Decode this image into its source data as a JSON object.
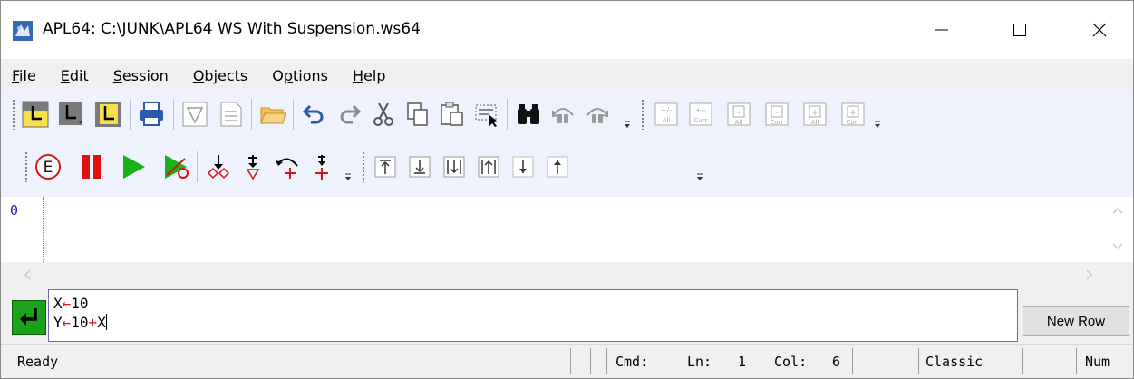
{
  "window": {
    "title": "APL64: C:\\JUNK\\APL64 WS With Suspension.ws64",
    "icon": "apl64-app-icon"
  },
  "menu": [
    {
      "label": "File",
      "underline": "F",
      "rest": "ile"
    },
    {
      "label": "Edit",
      "underline": "E",
      "rest": "dit"
    },
    {
      "label": "Session",
      "underline": "S",
      "rest": "ession"
    },
    {
      "label": "Objects",
      "underline": "O",
      "rest": "bjects"
    },
    {
      "label": "Options",
      "pre": "O",
      "underline": "p",
      "rest": "tions"
    },
    {
      "label": "Help",
      "underline": "H",
      "rest": "elp"
    }
  ],
  "toolbar1": {
    "icons": [
      "session-window-icon",
      "new-window-icon",
      "rebuild-window-icon",
      "print-icon",
      "find-icon",
      "notepad-icon",
      "open-folder-icon",
      "undo-icon",
      "redo-icon",
      "cut-icon",
      "copy-icon",
      "paste-icon",
      "select-icon",
      "binoculars-icon",
      "find-previous-icon",
      "find-next-icon",
      "toggle-all-icon",
      "toggle-current-icon",
      "collapse-all-icon",
      "collapse-current-icon",
      "expand-all-icon",
      "expand-current-icon"
    ],
    "small_labels": {
      "toggle_all": "+/-",
      "toggle_curr": "+/-",
      "all": "All",
      "curr": "Curr",
      "minus": "-",
      "plus": "+"
    }
  },
  "toolbar2": {
    "icons": [
      "error-icon",
      "pause-icon",
      "run-icon",
      "run-to-cursor-icon",
      "step-over-icon",
      "step-into-icon",
      "step-out-icon",
      "step-add-icon",
      "top-icon",
      "bottom-icon",
      "down-stop-icon",
      "up-stop-icon",
      "down-arrow-icon",
      "up-arrow-icon"
    ],
    "error_label": "E"
  },
  "session": {
    "line_number": "0"
  },
  "input": {
    "lines": [
      {
        "a": "X",
        "arrow": "←",
        "b": "10"
      },
      {
        "a": "Y",
        "arrow": "←",
        "b": "10",
        "plus": "+",
        "c": "X"
      }
    ],
    "new_row_label": "New Row"
  },
  "status": {
    "state": "Ready",
    "cmd": "Cmd:",
    "ln_label": "Ln:",
    "ln_value": "1",
    "col_label": "Col:",
    "col_value": "6",
    "mode": "Classic",
    "num": "Num"
  },
  "colors": {
    "toolbar_bg": "#edf2fc",
    "accent_green": "#1aa31a",
    "accent_red": "#d01a1a",
    "session_number": "#1a1ad0"
  }
}
